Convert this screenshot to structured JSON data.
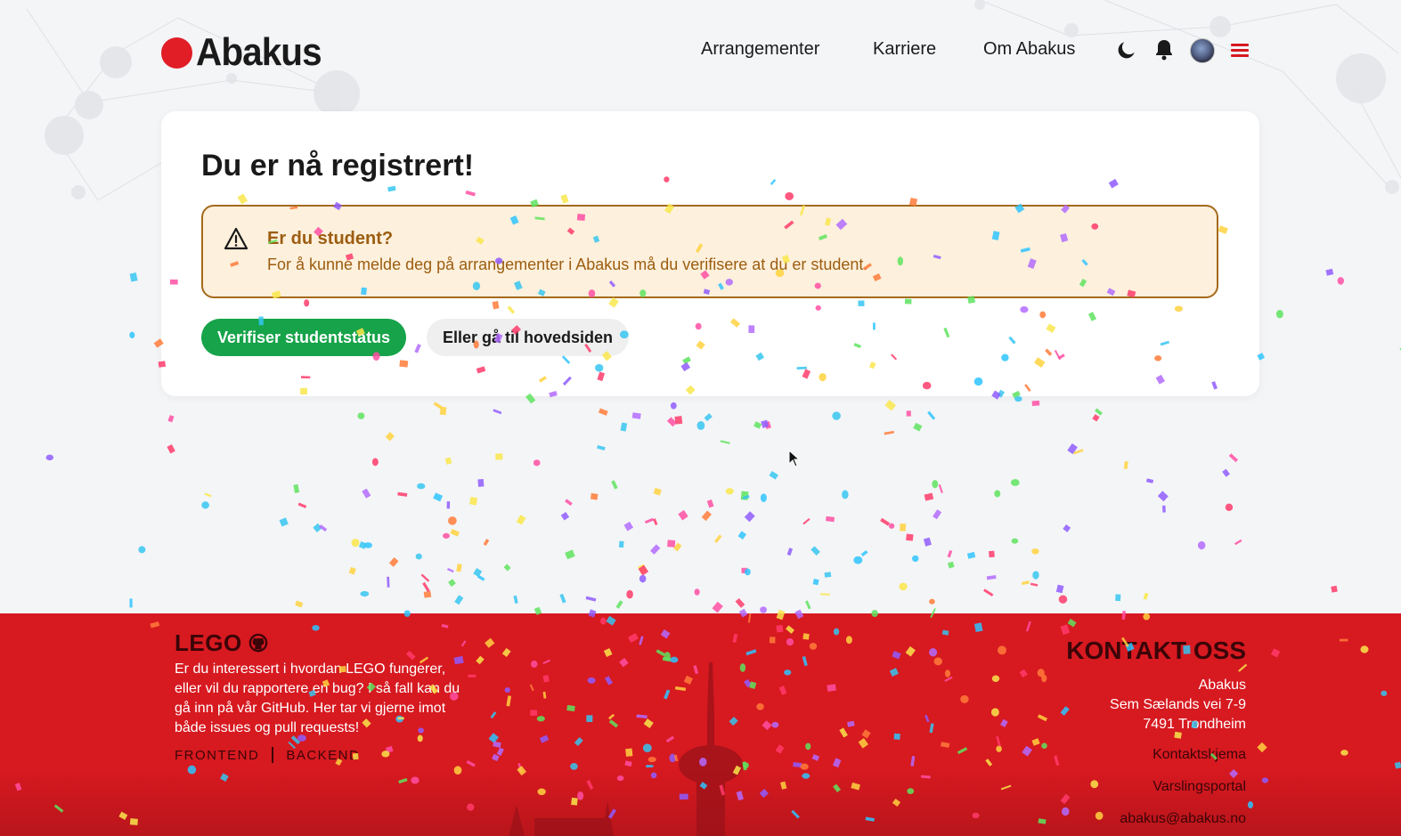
{
  "header": {
    "logo_text": "Abakus",
    "nav": [
      "Arrangementer",
      "Karriere",
      "Om Abakus"
    ],
    "icons": [
      "moon-icon",
      "bell-icon",
      "avatar",
      "menu-icon"
    ]
  },
  "card": {
    "title": "Du er nå registrert!",
    "alert_title": "Er du student?",
    "alert_text": "For å kunne melde deg på arrangementer i Abakus må du verifisere at du er student.",
    "primary_button": "Verifiser studentstatus",
    "secondary_button": "Eller gå til hovedsiden"
  },
  "footer": {
    "lego_title": "LEGO",
    "lego_text": "Er du interessert i hvordan LEGO fungerer, eller vil du rapportere en bug? I så fall kan du gå inn på vår GitHub. Her tar vi gjerne imot både issues og pull requests!",
    "links": [
      "FRONTEND",
      "BACKEND"
    ],
    "contact_title": "KONTAKT OSS",
    "address": [
      "Abakus",
      "Sem Sælands vei 7-9",
      "7491 Trondheim"
    ],
    "contact_links": [
      "Kontaktskjema",
      "Varslingsportal",
      "abakus@abakus.no"
    ]
  },
  "colors": {
    "brand_red": "#d71920",
    "success_green": "#16a34a",
    "warning_text": "#9c5d10",
    "warning_bg": "#fdf0dc"
  }
}
